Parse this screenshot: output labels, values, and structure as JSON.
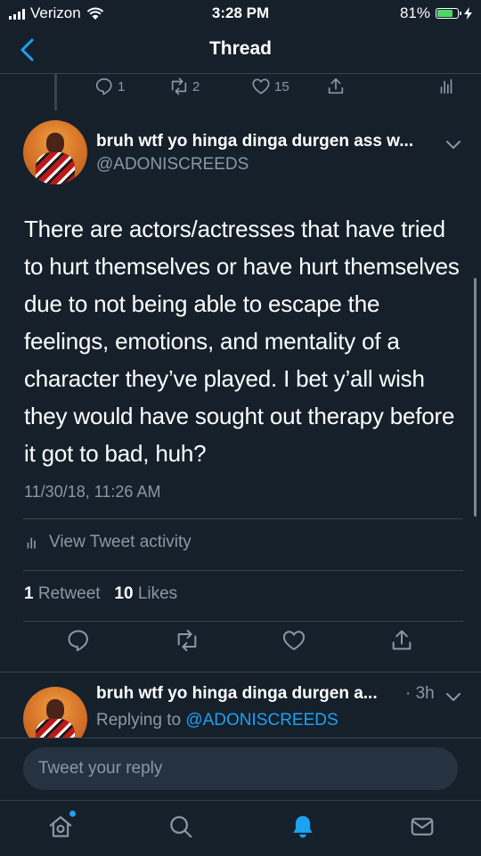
{
  "status_bar": {
    "carrier": "Verizon",
    "time": "3:28 PM",
    "battery_percent": "81%",
    "battery_level": 0.81
  },
  "nav": {
    "title": "Thread",
    "back_icon": "chevron-left-icon"
  },
  "previous_tweet_actions": {
    "reply_count": "1",
    "retweet_count": "2",
    "like_count": "15"
  },
  "tweet": {
    "author_name": "bruh wtf yo hinga dinga durgen ass w...",
    "author_handle": "@ADONISCREEDS",
    "text": "There are actors/actresses that have tried to hurt themselves or have hurt themselves due to not being able to escape the feelings, emotions, and mentality of a character they’ve played. I bet y’all wish they would have sought out therapy before it got to bad, huh?",
    "timestamp": "11/30/18, 11:26 AM",
    "activity_label": "View Tweet activity",
    "retweet_count": "1",
    "retweet_label": "Retweet",
    "like_count": "10",
    "like_label": "Likes"
  },
  "reply": {
    "author_name": "bruh wtf yo hinga dinga durgen a...",
    "age": "· 3h",
    "replying_prefix": "Replying to",
    "replying_handle": "@ADONISCREEDS"
  },
  "compose": {
    "placeholder": "Tweet your reply"
  },
  "tab_bar": {
    "items": [
      "home-icon",
      "search-icon",
      "notifications-icon",
      "messages-icon"
    ],
    "active": "notifications-icon"
  },
  "colors": {
    "background": "#15202b",
    "accent": "#1da1f2",
    "secondary_text": "#8899a6",
    "divider": "#38444d"
  }
}
